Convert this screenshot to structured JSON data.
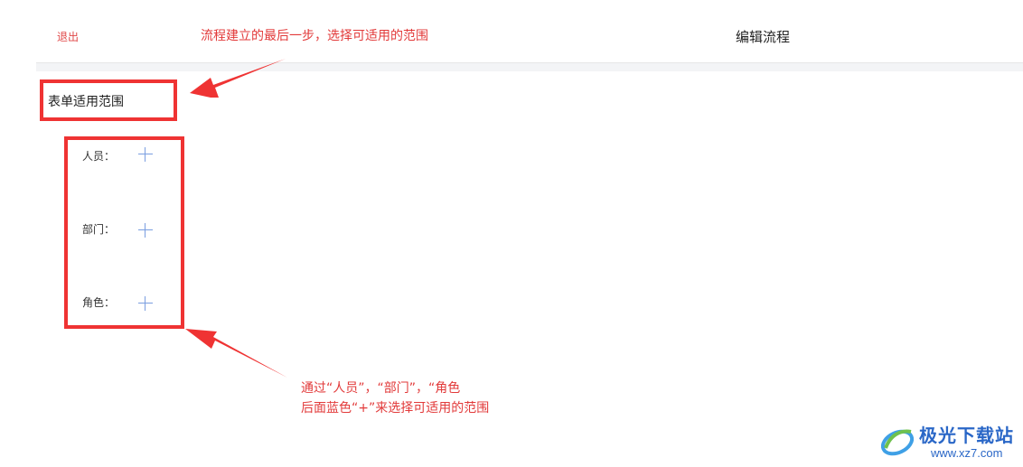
{
  "header": {
    "exit_label": "退出",
    "title": "编辑流程"
  },
  "annotations": {
    "top": "流程建立的最后一步，选择可适用的范围",
    "bottom_line1": "通过“人员”，“部门”，“角色",
    "bottom_line2": "后面蓝色“+”来选择可适用的范围"
  },
  "section": {
    "title": "表单适用范围"
  },
  "scope_items": [
    {
      "label": "人员：",
      "icon": "plus-icon"
    },
    {
      "label": "部门：",
      "icon": "plus-icon"
    },
    {
      "label": "角色：",
      "icon": "plus-icon"
    }
  ],
  "watermark": {
    "name": "极光下载站",
    "url": "www.xz7.com"
  },
  "colors": {
    "annotation_red": "#ef3333",
    "plus_blue": "#7a9ee0",
    "exit_red": "#e04848",
    "watermark_blue": "#2a67c7"
  }
}
